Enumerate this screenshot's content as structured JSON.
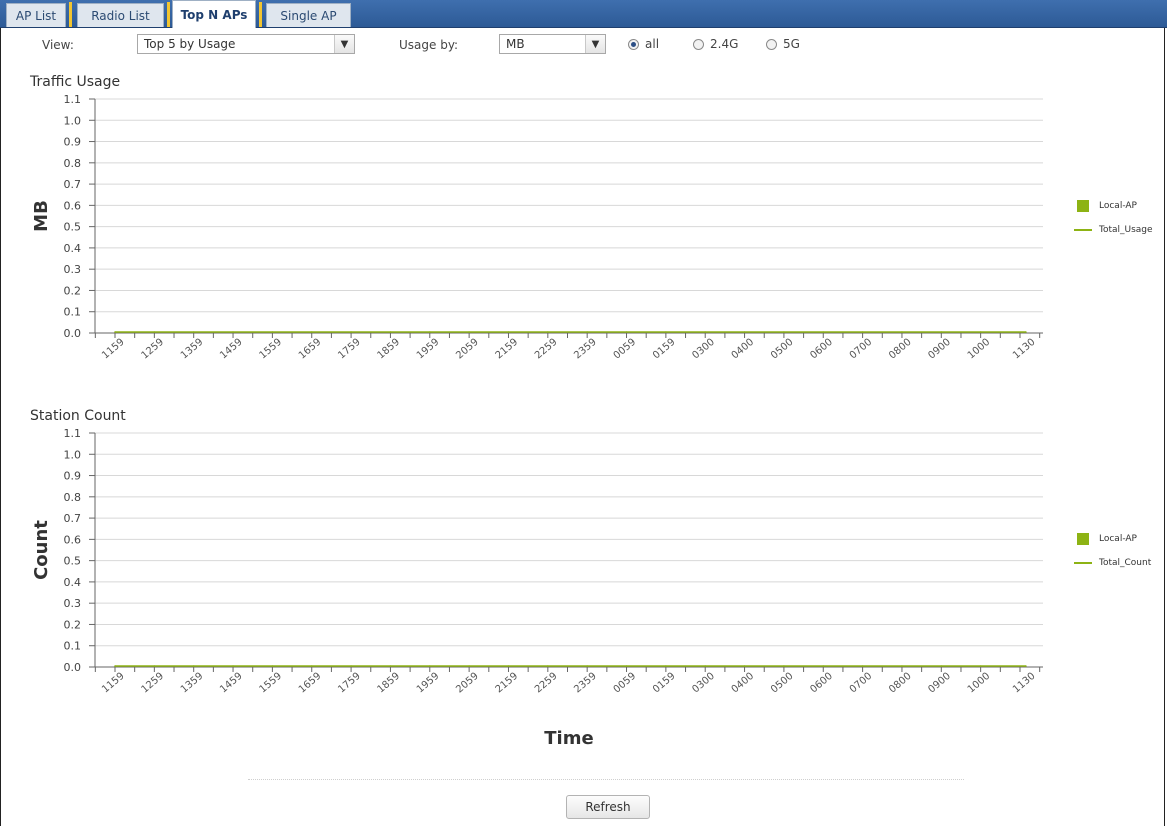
{
  "tabs": [
    {
      "label": "AP List",
      "active": false
    },
    {
      "label": "Radio List",
      "active": false
    },
    {
      "label": "Top N APs",
      "active": true
    },
    {
      "label": "Single AP",
      "active": false
    }
  ],
  "controls": {
    "view_label": "View:",
    "view_value": "Top 5 by Usage",
    "usage_label": "Usage by:",
    "usage_value": "MB",
    "radios": [
      {
        "label": "all",
        "selected": true
      },
      {
        "label": "2.4G",
        "selected": false
      },
      {
        "label": "5G",
        "selected": false
      }
    ]
  },
  "colors": {
    "series": "#8db314",
    "tab_accent": "#f2c530",
    "tabbar": "#2d5a96"
  },
  "chart_data": [
    {
      "type": "line",
      "title": "Traffic Usage",
      "xlabel": "",
      "ylabel": "MB",
      "ylim": [
        0,
        1.1
      ],
      "yticks": [
        "0.0",
        "0.1",
        "0.2",
        "0.3",
        "0.4",
        "0.5",
        "0.6",
        "0.7",
        "0.8",
        "0.9",
        "1.0",
        "1.1"
      ],
      "categories": [
        "1159",
        "1259",
        "1359",
        "1459",
        "1559",
        "1659",
        "1759",
        "1859",
        "1959",
        "2059",
        "2159",
        "2259",
        "2359",
        "0059",
        "0159",
        "0300",
        "0400",
        "0500",
        "0600",
        "0700",
        "0800",
        "0900",
        "1000",
        "1130"
      ],
      "grid": true,
      "legend_position": "right",
      "series": [
        {
          "name": "Local-AP",
          "kind": "bar",
          "values": [
            0,
            0,
            0,
            0,
            0,
            0,
            0,
            0,
            0,
            0,
            0,
            0,
            0,
            0,
            0,
            0,
            0,
            0,
            0,
            0,
            0,
            0,
            0,
            0
          ]
        },
        {
          "name": "Total_Usage",
          "kind": "line",
          "values": [
            0,
            0,
            0,
            0,
            0,
            0,
            0,
            0,
            0,
            0,
            0,
            0,
            0,
            0,
            0,
            0,
            0,
            0,
            0,
            0,
            0,
            0,
            0,
            0
          ]
        }
      ]
    },
    {
      "type": "line",
      "title": "Station Count",
      "xlabel": "Time",
      "ylabel": "Count",
      "ylim": [
        0,
        1.1
      ],
      "yticks": [
        "0.0",
        "0.1",
        "0.2",
        "0.3",
        "0.4",
        "0.5",
        "0.6",
        "0.7",
        "0.8",
        "0.9",
        "1.0",
        "1.1"
      ],
      "categories": [
        "1159",
        "1259",
        "1359",
        "1459",
        "1559",
        "1659",
        "1759",
        "1859",
        "1959",
        "2059",
        "2159",
        "2259",
        "2359",
        "0059",
        "0159",
        "0300",
        "0400",
        "0500",
        "0600",
        "0700",
        "0800",
        "0900",
        "1000",
        "1130"
      ],
      "grid": true,
      "legend_position": "right",
      "series": [
        {
          "name": "Local-AP",
          "kind": "bar",
          "values": [
            0,
            0,
            0,
            0,
            0,
            0,
            0,
            0,
            0,
            0,
            0,
            0,
            0,
            0,
            0,
            0,
            0,
            0,
            0,
            0,
            0,
            0,
            0,
            0
          ]
        },
        {
          "name": "Total_Count",
          "kind": "line",
          "values": [
            0,
            0,
            0,
            0,
            0,
            0,
            0,
            0,
            0,
            0,
            0,
            0,
            0,
            0,
            0,
            0,
            0,
            0,
            0,
            0,
            0,
            0,
            0,
            0
          ]
        }
      ]
    }
  ],
  "footer": {
    "refresh_label": "Refresh"
  }
}
